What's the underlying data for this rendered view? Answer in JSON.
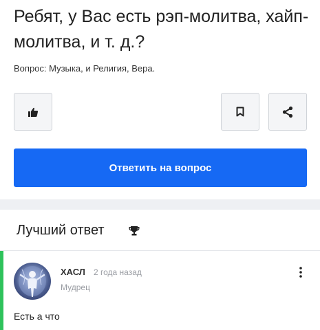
{
  "question": {
    "title": "Ребят, у Вас есть рэп-молитва, хайп-молитва, и т. д.?",
    "meta": "Вопрос: Музыка, и Религия, Вера."
  },
  "actions": {
    "like_icon": "thumbs-up-icon",
    "bookmark_icon": "bookmark-icon",
    "share_icon": "share-icon",
    "answer_button_label": "Ответить на вопрос",
    "answer_button_color": "#1669f4"
  },
  "best_answer": {
    "header": "Лучший ответ",
    "header_icon": "trophy-icon",
    "accent_color": "#2ec25b",
    "author": {
      "name": "ХАСЛ",
      "time": "2 года назад",
      "rank": "Мудрец"
    },
    "text": "Есть а что",
    "more_icon": "more-vertical-icon"
  }
}
